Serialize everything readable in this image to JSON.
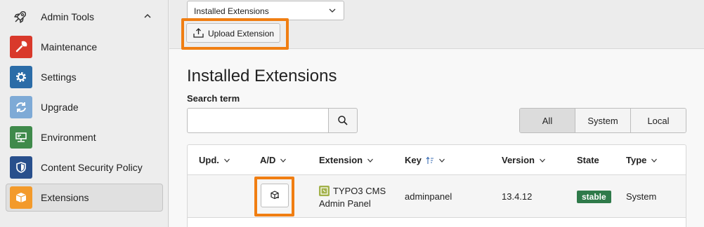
{
  "sidebar": {
    "group_title": "Admin Tools",
    "group_icon": "rocket-icon",
    "items": [
      {
        "label": "Maintenance",
        "icon": "wrench-icon",
        "color": "#d9392b"
      },
      {
        "label": "Settings",
        "icon": "gear-icon",
        "color": "#2b6ca7"
      },
      {
        "label": "Upgrade",
        "icon": "refresh-icon",
        "color": "#7eaad6"
      },
      {
        "label": "Environment",
        "icon": "server-icon",
        "color": "#3f8a4b"
      },
      {
        "label": "Content Security Policy",
        "icon": "shield-icon",
        "color": "#284f8c"
      },
      {
        "label": "Extensions",
        "icon": "box-icon",
        "color": "#f39a2b",
        "active": true
      }
    ]
  },
  "toolbar": {
    "view_select_value": "Installed Extensions",
    "upload_label": "Upload Extension"
  },
  "main": {
    "title": "Installed Extensions",
    "search_label": "Search term",
    "search_value": "",
    "filters": [
      {
        "label": "All",
        "selected": true
      },
      {
        "label": "System",
        "selected": false
      },
      {
        "label": "Local",
        "selected": false
      }
    ]
  },
  "table": {
    "headers": {
      "upd": "Upd.",
      "ad": "A/D",
      "extension": "Extension",
      "key": "Key",
      "version": "Version",
      "state": "State",
      "type": "Type"
    },
    "rows": [
      {
        "extension_name_line1": "TYPO3 CMS",
        "extension_name_line2": "Admin Panel",
        "key": "adminpanel",
        "version": "13.4.12",
        "state": "stable",
        "type": "System"
      }
    ]
  },
  "colors": {
    "highlight": "#f07e12",
    "stable_badge": "#2f7a4a"
  }
}
